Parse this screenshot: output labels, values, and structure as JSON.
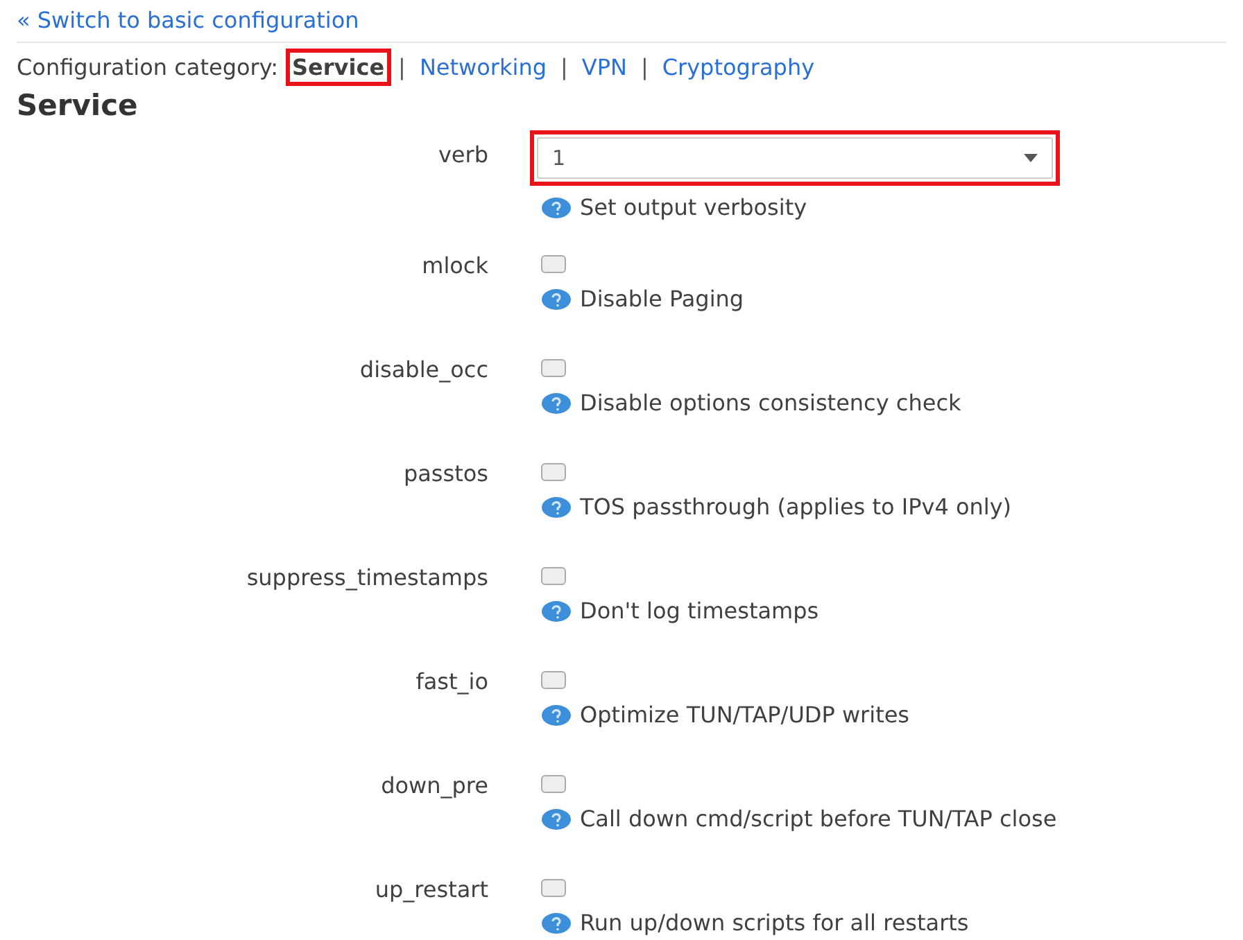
{
  "switch_link": "« Switch to basic configuration",
  "category_label": "Configuration category:",
  "categories": [
    {
      "label": "Service",
      "selected": true,
      "highlighted": true
    },
    {
      "label": "Networking",
      "selected": false,
      "highlighted": false
    },
    {
      "label": "VPN",
      "selected": false,
      "highlighted": false
    },
    {
      "label": "Cryptography",
      "selected": false,
      "highlighted": false
    }
  ],
  "separator": "|",
  "section_title": "Service",
  "options": [
    {
      "kind": "select",
      "name": "verb",
      "value": "1",
      "highlighted": true,
      "help": "Set output verbosity"
    },
    {
      "kind": "checkbox",
      "name": "mlock",
      "checked": false,
      "help": "Disable Paging"
    },
    {
      "kind": "checkbox",
      "name": "disable_occ",
      "checked": false,
      "help": "Disable options consistency check"
    },
    {
      "kind": "checkbox",
      "name": "passtos",
      "checked": false,
      "help": "TOS passthrough (applies to IPv4 only)"
    },
    {
      "kind": "checkbox",
      "name": "suppress_timestamps",
      "checked": false,
      "help": "Don't log timestamps"
    },
    {
      "kind": "checkbox",
      "name": "fast_io",
      "checked": false,
      "help": "Optimize TUN/TAP/UDP writes"
    },
    {
      "kind": "checkbox",
      "name": "down_pre",
      "checked": false,
      "help": "Call down cmd/script before TUN/TAP close"
    },
    {
      "kind": "checkbox",
      "name": "up_restart",
      "checked": false,
      "help": "Run up/down scripts for all restarts"
    }
  ]
}
